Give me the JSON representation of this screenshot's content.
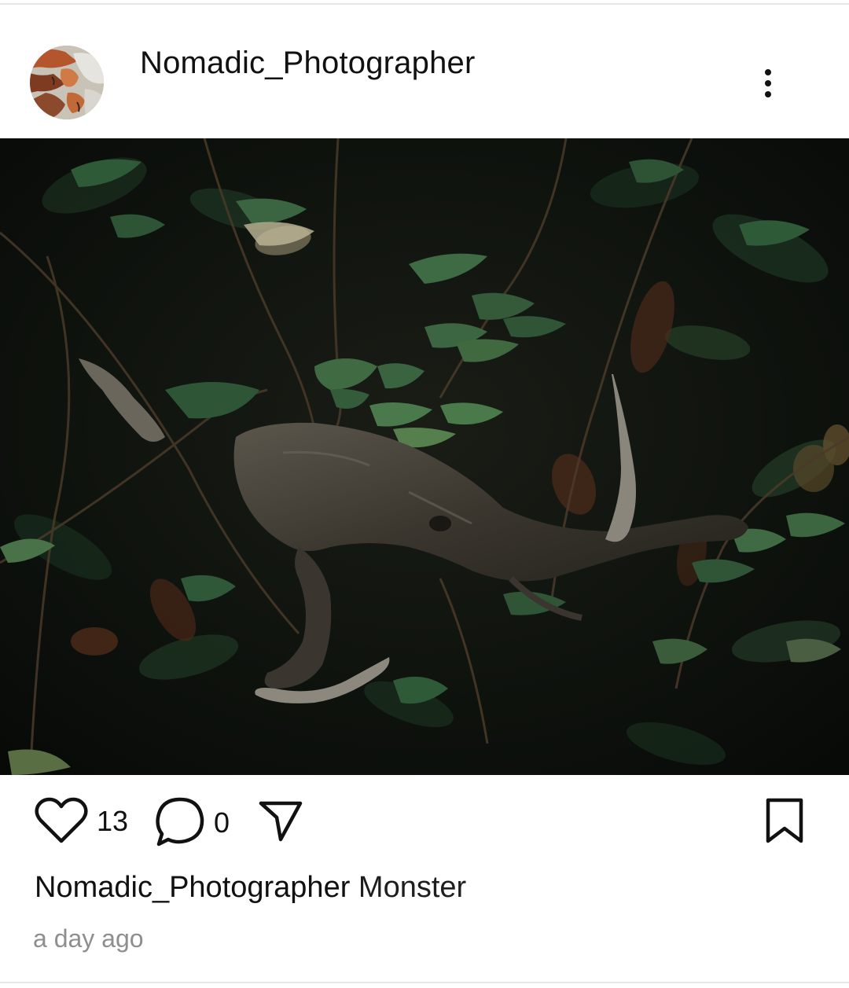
{
  "post": {
    "author": {
      "username": "Nomadic_Photographer"
    },
    "more_menu_icon": "more-vertical-icon",
    "image_subject": "gnarled branch among bramble leaves",
    "actions": {
      "like_icon": "heart-icon",
      "like_count": "13",
      "comment_icon": "comment-icon",
      "comment_count": "0",
      "share_icon": "send-icon",
      "save_icon": "bookmark-icon"
    },
    "caption": {
      "username": "Nomadic_Photographer",
      "text": "Monster"
    },
    "timestamp": "a day ago"
  },
  "colors": {
    "text": "#111111",
    "muted": "#8e8e8e",
    "divider": "#e6e6e6"
  }
}
